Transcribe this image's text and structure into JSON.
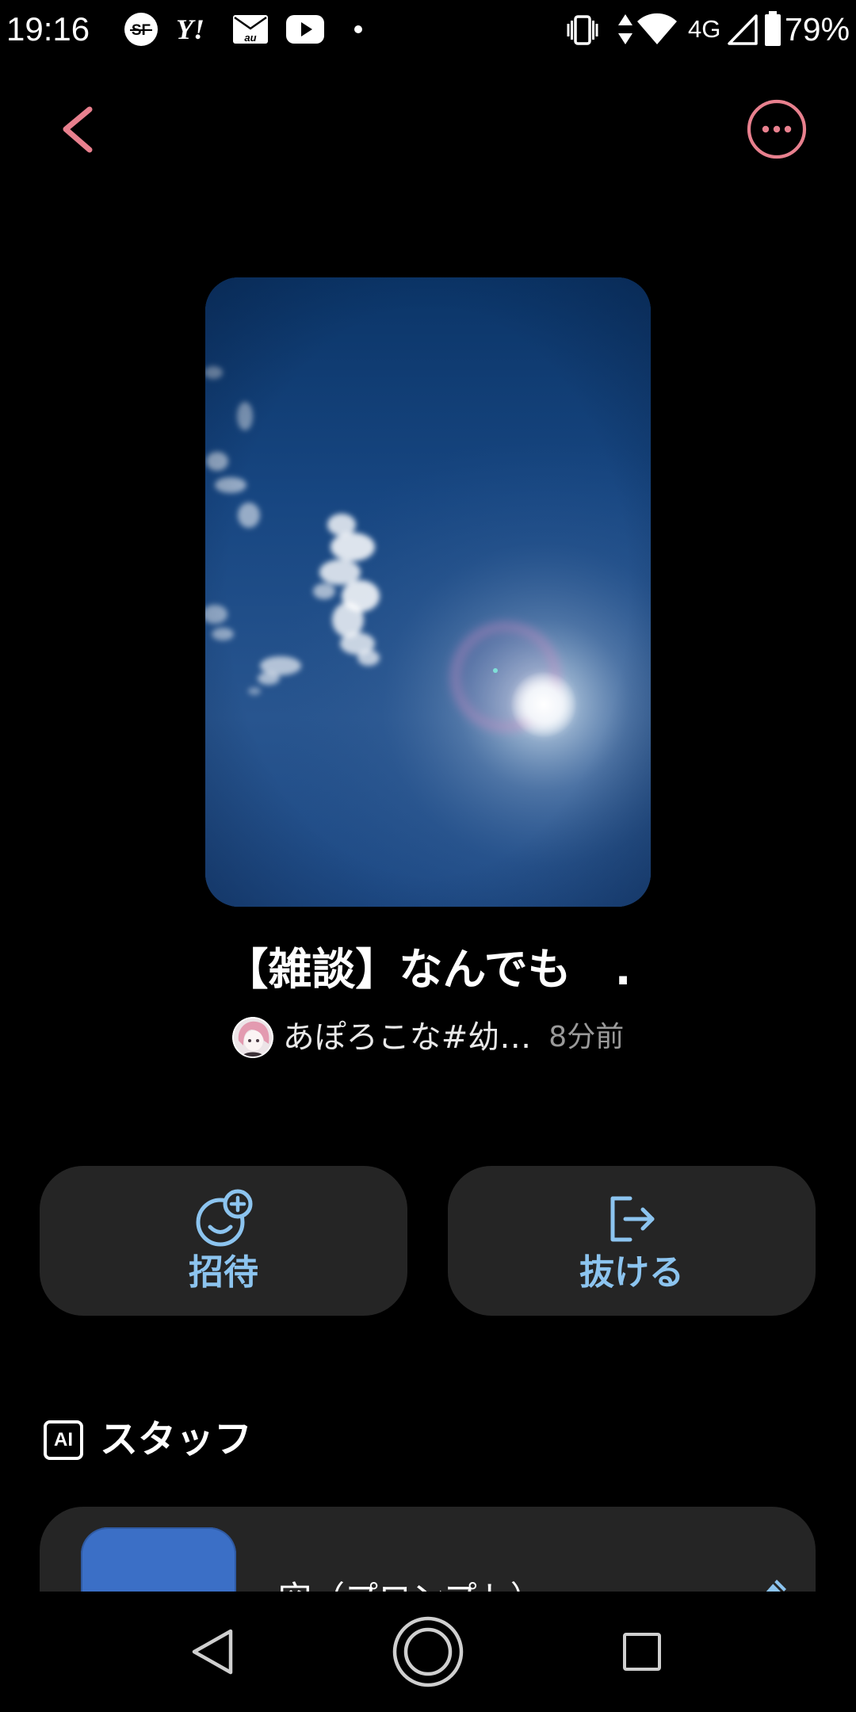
{
  "status_bar": {
    "time": "19:16",
    "notification_icons": {
      "sf": {
        "icon": "sf-app-icon",
        "text": "SF"
      },
      "yahoo": {
        "icon": "yahoo-icon",
        "text": "Y!"
      },
      "mail": {
        "icon": "au-mail-icon",
        "text": "au"
      },
      "youtube": {
        "icon": "youtube-icon"
      },
      "more": {
        "icon": "dot-icon"
      }
    },
    "system_icons": [
      "vibrate-icon",
      "data-activity-icon",
      "wifi-icon",
      "signal-icon",
      "battery-icon"
    ],
    "network_type": "4G",
    "battery_percent": "79%"
  },
  "header": {
    "back_icon": "chevron-left-icon",
    "menu_icon": "more-circle-icon"
  },
  "post": {
    "title": "【雑談】なんでも　.",
    "author_name": "あぽろこな#幼…",
    "posted_ago": "8分前"
  },
  "actions": [
    {
      "label": "招待",
      "icon": "invite-face-plus-icon"
    },
    {
      "label": "抜ける",
      "icon": "leave-exit-icon"
    }
  ],
  "staff_section": {
    "badge": "AI",
    "title": "スタッフ",
    "items": [
      {
        "name": "空（プロンプト）",
        "action_icon": "pencil-edit-icon"
      }
    ]
  },
  "nav_bar": {
    "icons": [
      "nav-back-icon",
      "nav-home-icon",
      "nav-recents-icon"
    ]
  },
  "colors": {
    "background": "#000000",
    "accent_pink": "#e8808e",
    "action_blue": "#8cc4ef",
    "surface": "#252525",
    "muted_text": "#9a9a9a",
    "staff_avatar": "#3b6fc6",
    "nav_icon": "#cfcfcf"
  }
}
